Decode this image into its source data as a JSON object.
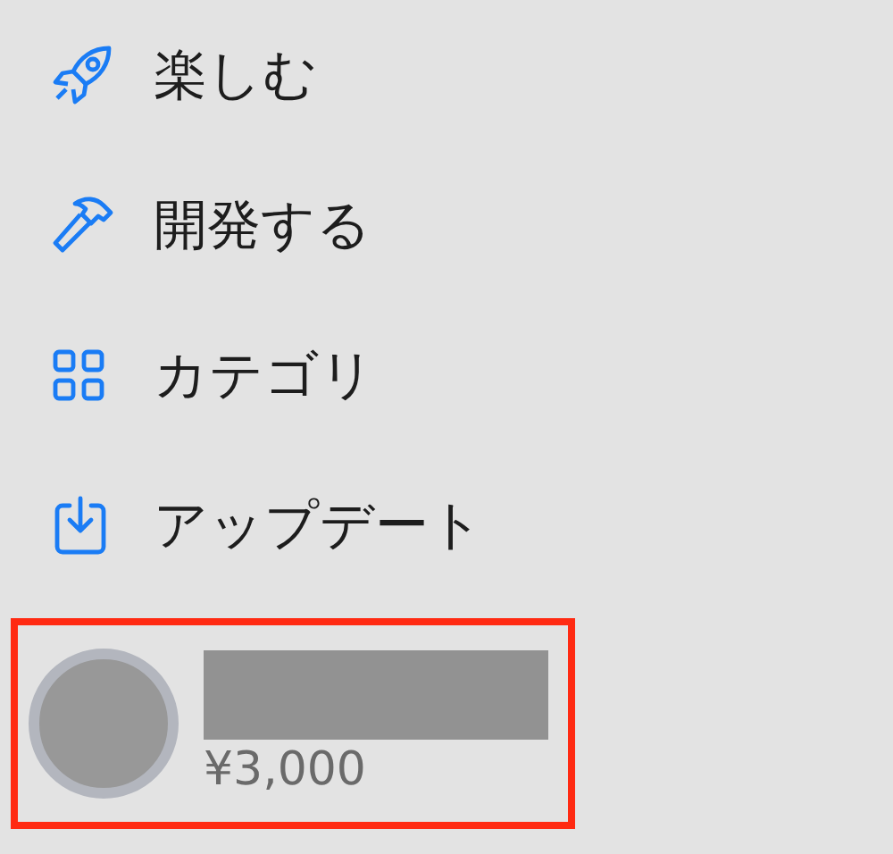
{
  "sidebar": {
    "items": [
      {
        "kind": "rocket",
        "label": "楽しむ"
      },
      {
        "kind": "hammer",
        "label": "開発する"
      },
      {
        "kind": "grid",
        "label": "カテゴリ"
      },
      {
        "kind": "download",
        "label": "アップデート"
      }
    ]
  },
  "account": {
    "highlighted": true,
    "balance": "¥3,000"
  }
}
